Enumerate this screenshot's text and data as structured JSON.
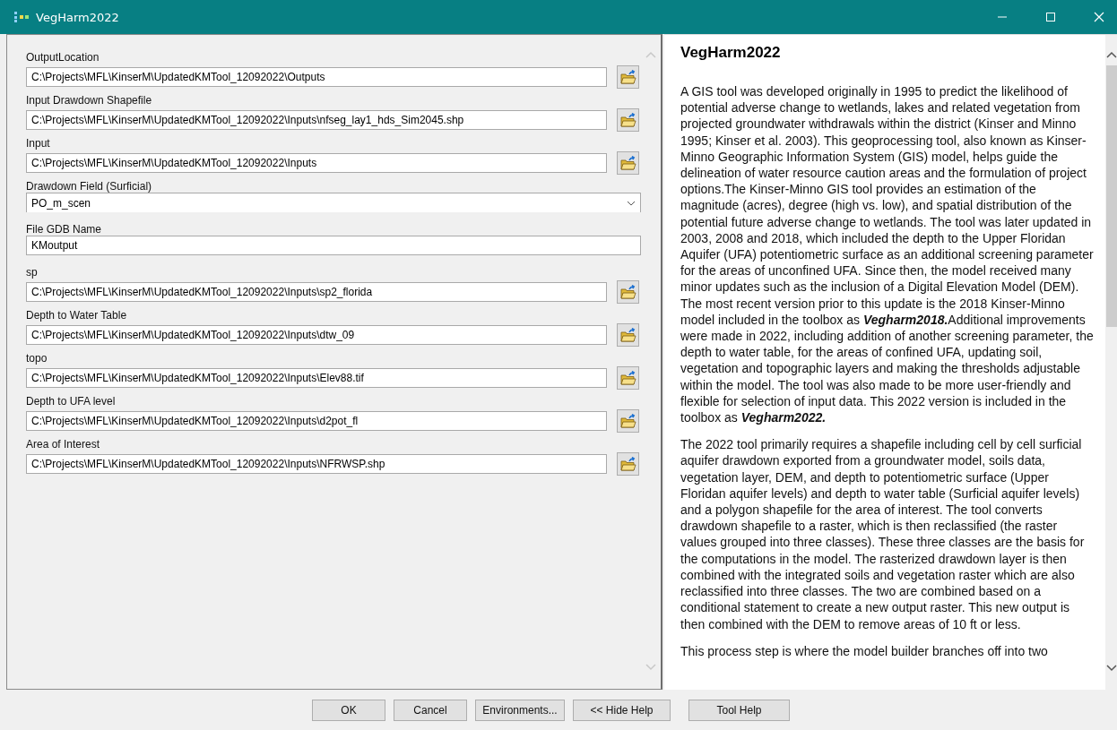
{
  "window": {
    "title": "VegHarm2022"
  },
  "parameters": [
    {
      "label": "OutputLocation",
      "kind": "path",
      "value": "C:\\Projects\\MFL\\KinserM\\UpdatedKMTool_12092022\\Outputs"
    },
    {
      "label": "Input Drawdown Shapefile",
      "kind": "path",
      "value": "C:\\Projects\\MFL\\KinserM\\UpdatedKMTool_12092022\\Inputs\\nfseg_lay1_hds_Sim2045.shp"
    },
    {
      "label": "Input",
      "kind": "path",
      "value": "C:\\Projects\\MFL\\KinserM\\UpdatedKMTool_12092022\\Inputs"
    },
    {
      "label": "Drawdown Field (Surficial)",
      "kind": "dropdown",
      "value": "PO_m_scen"
    },
    {
      "label": "File GDB Name",
      "kind": "text",
      "value": "KMoutput"
    },
    {
      "label": "sp",
      "kind": "path",
      "value": "C:\\Projects\\MFL\\KinserM\\UpdatedKMTool_12092022\\Inputs\\sp2_florida"
    },
    {
      "label": "Depth to Water Table",
      "kind": "path",
      "value": "C:\\Projects\\MFL\\KinserM\\UpdatedKMTool_12092022\\Inputs\\dtw_09"
    },
    {
      "label": "topo",
      "kind": "path",
      "value": "C:\\Projects\\MFL\\KinserM\\UpdatedKMTool_12092022\\Inputs\\Elev88.tif"
    },
    {
      "label": "Depth to UFA level",
      "kind": "path",
      "value": "C:\\Projects\\MFL\\KinserM\\UpdatedKMTool_12092022\\Inputs\\d2pot_fl"
    },
    {
      "label": "Area of Interest",
      "kind": "path",
      "value": "C:\\Projects\\MFL\\KinserM\\UpdatedKMTool_12092022\\Inputs\\NFRWSP.shp"
    }
  ],
  "help": {
    "title": "VegHarm2022",
    "paragraphs": [
      "A GIS tool was developed originally in 1995 to predict the likelihood of potential adverse change to wetlands, lakes and related vegetation from projected groundwater withdrawals within the district (Kinser and Minno 1995; Kinser et al. 2003). This geoprocessing tool, also known as Kinser-Minno Geographic Information System (GIS) model, helps guide the delineation of water resource caution areas and the formulation of project options.The Kinser-Minno GIS tool provides an estimation of the magnitude (acres), degree (high vs. low), and spatial distribution of the potential future adverse change to wetlands. The tool was later updated in 2003, 2008 and 2018, which included the depth to the Upper Floridan Aquifer (UFA) potentiometric surface as an additional screening parameter for the areas of unconfined UFA. Since then, the model received many minor updates such as the inclusion of a Digital Elevation Model (DEM). The most recent version prior to this update is the 2018 Kinser-Minno model included in the toolbox as **Vegharm2018.**Additional improvements were made in 2022, including addition of another screening parameter, the depth to water table, for the areas of confined UFA, updating soil, vegetation and topographic layers and making the thresholds adjustable within the model. The tool was also made to be more user-friendly and flexible for selection of input data. This 2022 version is included in the toolbox as **Vegharm2022.**",
      "The 2022 tool primarily requires a shapefile including cell by cell surficial aquifer drawdown exported from a groundwater model, soils data, vegetation layer, DEM, and depth to potentiometric surface (Upper Floridan aquifer levels) and depth to water table (Surficial aquifer levels) and a polygon shapefile for the area of interest. The tool converts drawdown shapefile to a raster, which is then reclassified (the raster values grouped into three classes). These three classes are the basis for the computations in the model. The rasterized drawdown layer is then combined with the integrated soils and vegetation raster which are also reclassified into three classes. The two are combined based on a conditional statement to create a new output raster. This new output is then combined with the DEM to remove areas of 10 ft or less.",
      "This process step is where the model builder branches off into two"
    ]
  },
  "buttons": [
    "OK",
    "Cancel",
    "Environments...",
    "<< Hide Help"
  ],
  "help_button": "Tool Help"
}
